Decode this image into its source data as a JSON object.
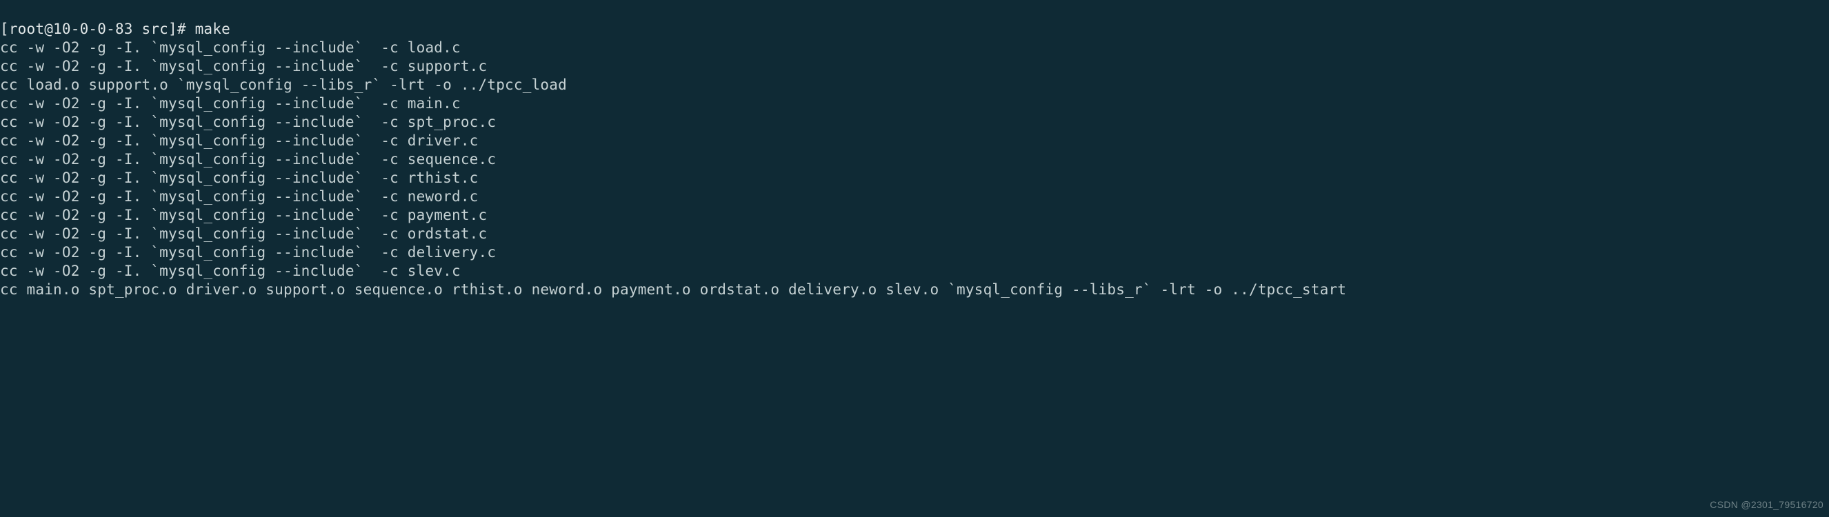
{
  "prompt": {
    "user": "root",
    "host": "10-0-0-83",
    "dir": "src",
    "symbol": "#",
    "command": "make"
  },
  "lines": [
    "cc -w -O2 -g -I. `mysql_config --include`  -c load.c",
    "cc -w -O2 -g -I. `mysql_config --include`  -c support.c",
    "cc load.o support.o `mysql_config --libs_r` -lrt -o ../tpcc_load",
    "cc -w -O2 -g -I. `mysql_config --include`  -c main.c",
    "cc -w -O2 -g -I. `mysql_config --include`  -c spt_proc.c",
    "cc -w -O2 -g -I. `mysql_config --include`  -c driver.c",
    "cc -w -O2 -g -I. `mysql_config --include`  -c sequence.c",
    "cc -w -O2 -g -I. `mysql_config --include`  -c rthist.c",
    "cc -w -O2 -g -I. `mysql_config --include`  -c neword.c",
    "cc -w -O2 -g -I. `mysql_config --include`  -c payment.c",
    "cc -w -O2 -g -I. `mysql_config --include`  -c ordstat.c",
    "cc -w -O2 -g -I. `mysql_config --include`  -c delivery.c",
    "cc -w -O2 -g -I. `mysql_config --include`  -c slev.c",
    "cc main.o spt_proc.o driver.o support.o sequence.o rthist.o neword.o payment.o ordstat.o delivery.o slev.o `mysql_config --libs_r` -lrt -o ../tpcc_start"
  ],
  "watermark": "CSDN @2301_79516720"
}
